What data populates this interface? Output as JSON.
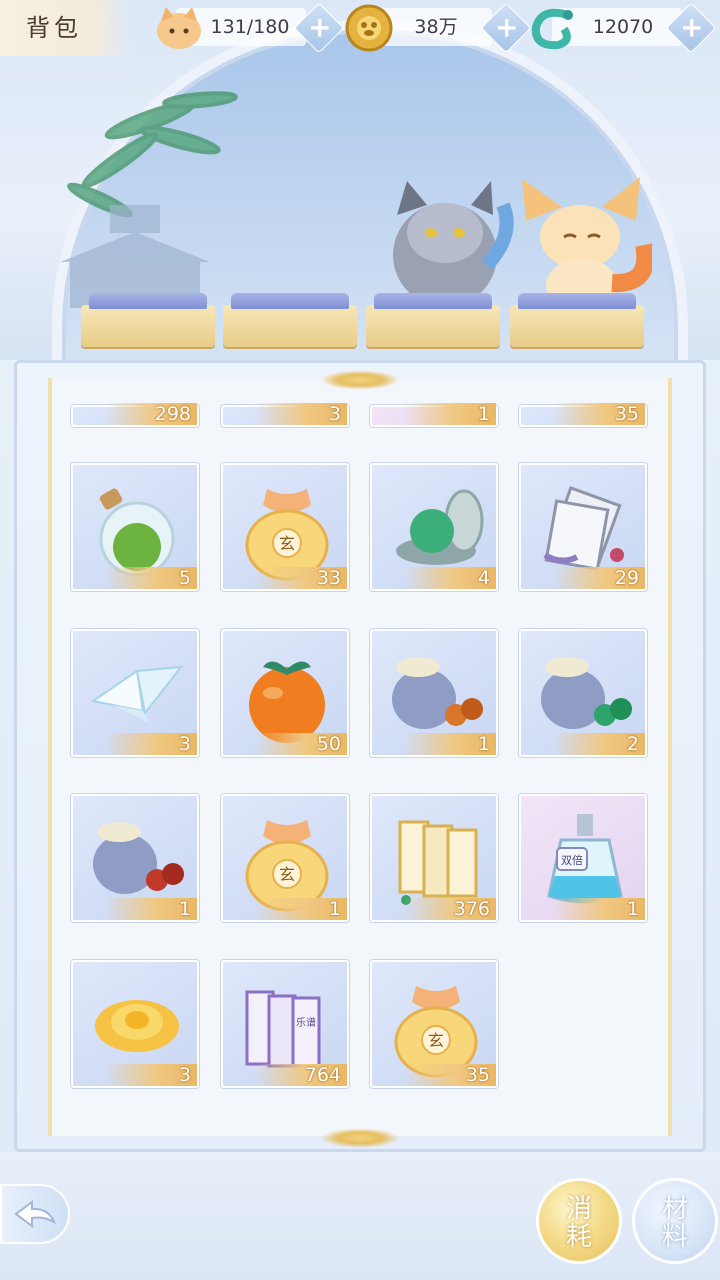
{
  "header": {
    "title": "背包",
    "resources": [
      {
        "icon": "cat-face-icon",
        "value": "131/180"
      },
      {
        "icon": "gold-coin-icon",
        "value": "38万"
      },
      {
        "icon": "jade-dragon-icon",
        "value": "12070"
      }
    ],
    "plus_label": "+"
  },
  "grid": {
    "partial_row": [
      "298",
      "3",
      "1",
      "35"
    ],
    "rows": [
      [
        {
          "icon": "green-potion-bottle-icon",
          "count": "5"
        },
        {
          "icon": "golden-pouch-icon",
          "count": "33"
        },
        {
          "icon": "green-jade-orb-icon",
          "count": "4"
        },
        {
          "icon": "scroll-bundle-icon",
          "count": "29"
        }
      ],
      [
        {
          "icon": "paper-crane-icon",
          "count": "3"
        },
        {
          "icon": "orange-persimmon-icon",
          "count": "50"
        },
        {
          "icon": "blue-sack-orange-beads-icon",
          "count": "1"
        },
        {
          "icon": "blue-sack-green-beads-icon",
          "count": "2"
        }
      ],
      [
        {
          "icon": "blue-sack-red-beads-icon",
          "count": "1"
        },
        {
          "icon": "golden-pouch-icon",
          "count": "1"
        },
        {
          "icon": "golden-book-set-icon",
          "count": "376"
        },
        {
          "icon": "double-exp-potion-icon",
          "count": "1"
        }
      ],
      [
        {
          "icon": "yellow-rose-icon",
          "count": "3"
        },
        {
          "icon": "purple-book-set-icon",
          "count": "764"
        },
        {
          "icon": "golden-pouch-icon",
          "count": "35"
        }
      ]
    ]
  },
  "labels": {
    "pouch_char": "玄",
    "potion_label": "双倍",
    "book_label": "乐谱"
  },
  "bottom": {
    "consume_label": "消耗",
    "material_label": "材料"
  }
}
